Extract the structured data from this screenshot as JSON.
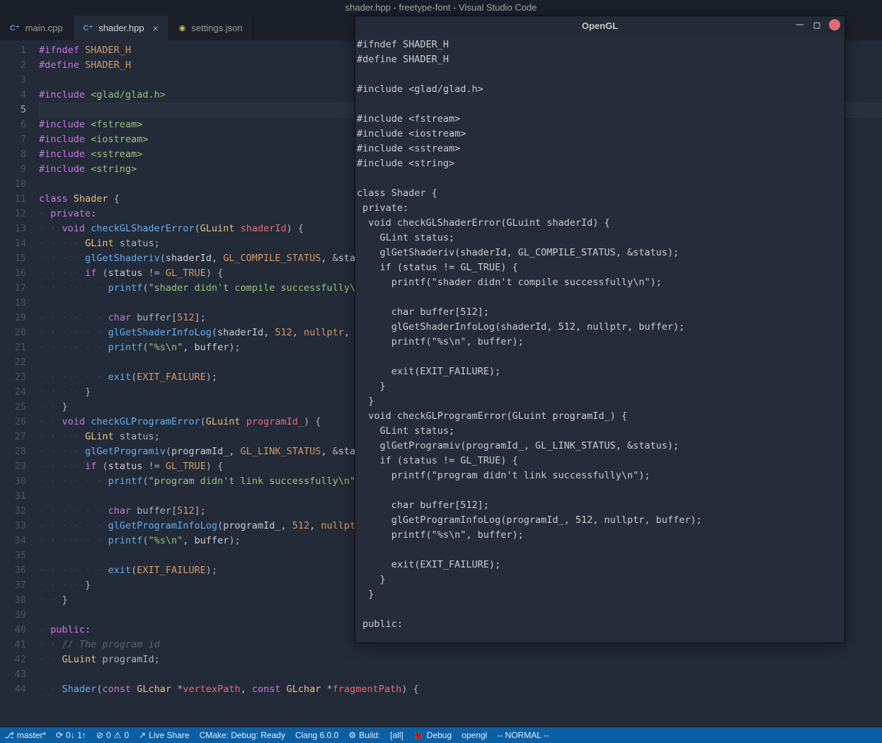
{
  "window": {
    "title": "shader.hpp - freetype-font - Visual Studio Code"
  },
  "tabs": [
    {
      "label": "main.cpp",
      "icon": "cpp",
      "active": false,
      "close": false
    },
    {
      "label": "shader.hpp",
      "icon": "cpp",
      "active": true,
      "close": true
    },
    {
      "label": "settings.json",
      "icon": "json",
      "active": false,
      "close": false
    }
  ],
  "editor": {
    "current_line": 5,
    "line_count": 44,
    "lines_html": [
      "<span class='kw-def'>#ifndef</span> <span class='macro'>SHADER_H</span>",
      "<span class='kw-def'>#define</span> <span class='macro'>SHADER_H</span>",
      "",
      "<span class='kw-def'>#include</span> <span class='inc'>&lt;glad/glad.h&gt;</span>",
      "",
      "<span class='kw-def'>#include</span> <span class='inc'>&lt;fstream&gt;</span>",
      "<span class='kw-def'>#include</span> <span class='inc'>&lt;iostream&gt;</span>",
      "<span class='kw-def'>#include</span> <span class='inc'>&lt;sstream&gt;</span>",
      "<span class='kw-def'>#include</span> <span class='inc'>&lt;string&gt;</span>",
      "",
      "<span class='kw-def'>class</span> <span class='ty'>Shader</span> <span class='punc'>{</span>",
      "<span class='guide'>·</span><span class='kw-def'>private</span><span class='punc'>:</span>",
      "<span class='guide'>·</span><span class='guide'>·</span><span class='kw-type'>void</span> <span class='fn'>checkGLShaderError</span><span class='punc'>(</span><span class='ty'>GLuint</span> <span class='var'>shaderId</span><span class='punc'>)</span> <span class='punc'>{</span>",
      "<span class='guide'>·</span><span class='guide'>·</span><span class='guide'>·</span><span class='guide'>·</span><span class='ty'>GLint</span> <span class='op'>status;</span>",
      "<span class='guide'>·</span><span class='guide'>·</span><span class='guide'>·</span><span class='guide'>·</span><span class='fn'>glGetShaderiv</span><span class='punc'>(</span>shaderId, <span class='macro'>GL_COMPILE_STATUS</span>, <span class='op'>&amp;</span>status<span class='punc'>);</span>",
      "<span class='guide'>·</span><span class='guide'>·</span><span class='guide'>·</span><span class='guide'>·</span><span class='kw-def'>if</span> <span class='punc'>(</span>status <span class='op'>!=</span> <span class='macro'>GL_TRUE</span><span class='punc'>)</span> <span class='punc'>{</span>",
      "<span class='guide'>·</span><span class='guide'>·</span><span class='guide'>·</span><span class='guide'>·</span><span class='guide'>·</span><span class='guide'>·</span><span class='fn'>printf</span><span class='punc'>(</span><span class='str'>\"shader didn't compile successfully\\n\"</span><span class='punc'>);</span>",
      "",
      "<span class='guide'>·</span><span class='guide'>·</span><span class='guide'>·</span><span class='guide'>·</span><span class='guide'>·</span><span class='guide'>·</span><span class='kw-type'>char</span> <span class='op'>buffer[</span><span class='macro'>512</span><span class='op'>];</span>",
      "<span class='guide'>·</span><span class='guide'>·</span><span class='guide'>·</span><span class='guide'>·</span><span class='guide'>·</span><span class='guide'>·</span><span class='fn'>glGetShaderInfoLog</span><span class='punc'>(</span>shaderId, <span class='macro'>512</span>, <span class='nul'>nullptr</span>, buffer<span class='punc'>);</span>",
      "<span class='guide'>·</span><span class='guide'>·</span><span class='guide'>·</span><span class='guide'>·</span><span class='guide'>·</span><span class='guide'>·</span><span class='fn'>printf</span><span class='punc'>(</span><span class='str'>\"%s\\n\"</span>, buffer<span class='punc'>);</span>",
      "",
      "<span class='guide'>·</span><span class='guide'>·</span><span class='guide'>·</span><span class='guide'>·</span><span class='guide'>·</span><span class='guide'>·</span><span class='fn'>exit</span><span class='punc'>(</span><span class='macro'>EXIT_FAILURE</span><span class='punc'>);</span>",
      "<span class='guide'>·</span><span class='guide'>·</span><span class='guide'>·</span><span class='guide'>·</span><span class='punc'>}</span>",
      "<span class='guide'>·</span><span class='guide'>·</span><span class='punc'>}</span>",
      "<span class='guide'>·</span><span class='guide'>·</span><span class='kw-type'>void</span> <span class='fn'>checkGLProgramError</span><span class='punc'>(</span><span class='ty'>GLuint</span> <span class='var'>programId_</span><span class='punc'>)</span> <span class='punc'>{</span>",
      "<span class='guide'>·</span><span class='guide'>·</span><span class='guide'>·</span><span class='guide'>·</span><span class='ty'>GLint</span> <span class='op'>status;</span>",
      "<span class='guide'>·</span><span class='guide'>·</span><span class='guide'>·</span><span class='guide'>·</span><span class='fn'>glGetProgramiv</span><span class='punc'>(</span>programId_, <span class='macro'>GL_LINK_STATUS</span>, <span class='op'>&amp;</span>status<span class='punc'>);</span>",
      "<span class='guide'>·</span><span class='guide'>·</span><span class='guide'>·</span><span class='guide'>·</span><span class='kw-def'>if</span> <span class='punc'>(</span>status <span class='op'>!=</span> <span class='macro'>GL_TRUE</span><span class='punc'>)</span> <span class='punc'>{</span>",
      "<span class='guide'>·</span><span class='guide'>·</span><span class='guide'>·</span><span class='guide'>·</span><span class='guide'>·</span><span class='guide'>·</span><span class='fn'>printf</span><span class='punc'>(</span><span class='str'>\"program didn't link successfully\\n\"</span><span class='punc'>);</span>",
      "",
      "<span class='guide'>·</span><span class='guide'>·</span><span class='guide'>·</span><span class='guide'>·</span><span class='guide'>·</span><span class='guide'>·</span><span class='kw-type'>char</span> <span class='op'>buffer[</span><span class='macro'>512</span><span class='op'>];</span>",
      "<span class='guide'>·</span><span class='guide'>·</span><span class='guide'>·</span><span class='guide'>·</span><span class='guide'>·</span><span class='guide'>·</span><span class='fn'>glGetProgramInfoLog</span><span class='punc'>(</span>programId_, <span class='macro'>512</span>, <span class='nul'>nullptr</span>, buffer<span class='punc'>);</span>",
      "<span class='guide'>·</span><span class='guide'>·</span><span class='guide'>·</span><span class='guide'>·</span><span class='guide'>·</span><span class='guide'>·</span><span class='fn'>printf</span><span class='punc'>(</span><span class='str'>\"%s\\n\"</span>, buffer<span class='punc'>);</span>",
      "",
      "<span class='guide'>·</span><span class='guide'>·</span><span class='guide'>·</span><span class='guide'>·</span><span class='guide'>·</span><span class='guide'>·</span><span class='fn'>exit</span><span class='punc'>(</span><span class='macro'>EXIT_FAILURE</span><span class='punc'>);</span>",
      "<span class='guide'>·</span><span class='guide'>·</span><span class='guide'>·</span><span class='guide'>·</span><span class='punc'>}</span>",
      "<span class='guide'>·</span><span class='guide'>·</span><span class='punc'>}</span>",
      "",
      "<span class='guide'>·</span><span class='kw-def'>public</span><span class='punc'>:</span>",
      "<span class='guide'>·</span><span class='guide'>·</span><span class='comment'>// The program id</span>",
      "<span class='guide'>·</span><span class='guide'>·</span><span class='ty'>GLuint</span> <span class='op'>programId;</span>",
      "",
      "<span class='guide'>·</span><span class='guide'>·</span><span class='fn'>Shader</span><span class='punc'>(</span><span class='kw-type'>const</span> <span class='ty'>GLchar</span> <span class='op'>*</span><span class='var'>vertexPath</span>, <span class='kw-type'>const</span> <span class='ty'>GLchar</span> <span class='op'>*</span><span class='var'>fragmentPath</span><span class='punc'>)</span> <span class='punc'>{</span>"
    ]
  },
  "opengl": {
    "title": "OpenGL",
    "text": "#ifndef SHADER_H\n#define SHADER_H\n\n#include <glad/glad.h>\n\n#include <fstream>\n#include <iostream>\n#include <sstream>\n#include <string>\n\nclass Shader {\n private:\n  void checkGLShaderError(GLuint shaderId) {\n    GLint status;\n    glGetShaderiv(shaderId, GL_COMPILE_STATUS, &status);\n    if (status != GL_TRUE) {\n      printf(\"shader didn't compile successfully\\n\");\n\n      char buffer[512];\n      glGetShaderInfoLog(shaderId, 512, nullptr, buffer);\n      printf(\"%s\\n\", buffer);\n\n      exit(EXIT_FAILURE);\n    }\n  }\n  void checkGLProgramError(GLuint programId_) {\n    GLint status;\n    glGetProgramiv(programId_, GL_LINK_STATUS, &status);\n    if (status != GL_TRUE) {\n      printf(\"program didn't link successfully\\n\");\n\n      char buffer[512];\n      glGetProgramInfoLog(programId_, 512, nullptr, buffer);\n      printf(\"%s\\n\", buffer);\n\n      exit(EXIT_FAILURE);\n    }\n  }\n\n public:"
  },
  "status": {
    "branch": "master*",
    "sync": "0↓ 1↑",
    "errors": "0",
    "warnings": "0",
    "liveshare": "Live Share",
    "cmake": "CMake: Debug: Ready",
    "compiler": "Clang 6.0.0",
    "build": "Build:",
    "build_target": "[all]",
    "debug": "Debug",
    "debug_target": "opengl",
    "vim": "-- NORMAL --"
  }
}
